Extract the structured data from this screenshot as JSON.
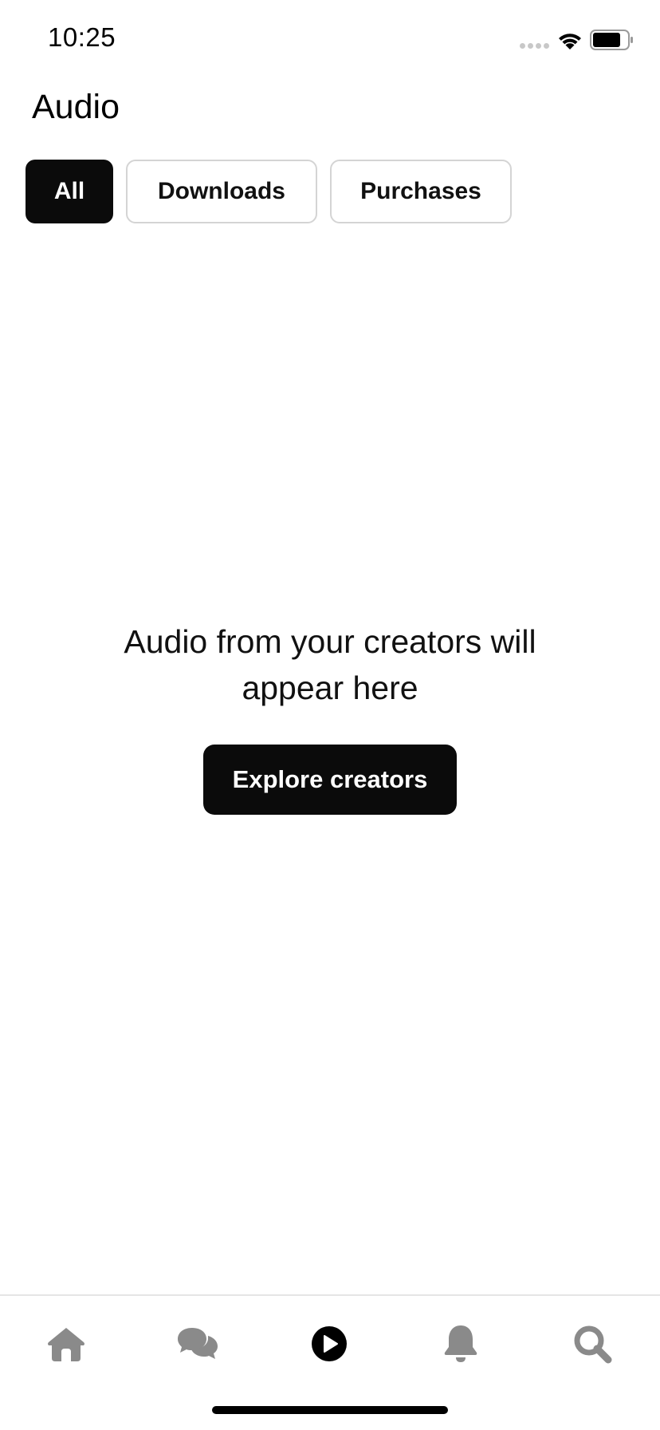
{
  "status_bar": {
    "time": "10:25",
    "icons": [
      "signal-dots-icon",
      "wifi-icon",
      "battery-icon"
    ]
  },
  "page": {
    "title": "Audio"
  },
  "filters": {
    "items": [
      {
        "label": "All",
        "active": true
      },
      {
        "label": "Downloads",
        "active": false
      },
      {
        "label": "Purchases",
        "active": false
      }
    ]
  },
  "empty_state": {
    "message": "Audio from your creators will appear here",
    "button_label": "Explore creators"
  },
  "bottom_nav": {
    "items": [
      {
        "icon": "home-icon",
        "active": false
      },
      {
        "icon": "chat-icon",
        "active": false
      },
      {
        "icon": "audio-play-icon",
        "active": true
      },
      {
        "icon": "bell-icon",
        "active": false
      },
      {
        "icon": "search-icon",
        "active": false
      }
    ]
  },
  "colors": {
    "primary": "#0b0b0b",
    "inactive_icon": "#8a8a8a",
    "chip_border": "#d4d4d4",
    "background": "#ffffff"
  }
}
